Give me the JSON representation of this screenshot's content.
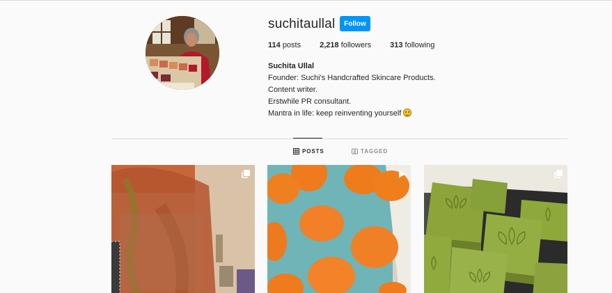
{
  "profile": {
    "username": "suchitaullal",
    "follow_label": "Follow",
    "stats": {
      "posts_count": "114",
      "posts_label": "posts",
      "followers_count": "2,218",
      "followers_label": "followers",
      "following_count": "313",
      "following_label": "following"
    },
    "full_name": "Suchita Ullal",
    "bio_lines": [
      "Founder: Suchi's Handcrafted Skincare Products.",
      "Content writer.",
      "Erstwhile PR consultant.",
      "Mantra in life: keep reinventing yourself"
    ],
    "bio_emoji": "slightly-smiling-face-emoji"
  },
  "tabs": [
    {
      "label": "POSTS",
      "icon": "grid-icon",
      "active": true
    },
    {
      "label": "TAGGED",
      "icon": "tagged-icon",
      "active": false
    }
  ],
  "posts": [
    {
      "icon": "multiple-images-icon",
      "subject": "wrapped soap gift in orange mesh"
    },
    {
      "icon": "video-play-icon",
      "subject": "orange soap rounds in blue mold"
    },
    {
      "icon": "multiple-images-icon",
      "subject": "green lotus-stamped soap bars"
    }
  ],
  "colors": {
    "accent": "#0095f6",
    "text": "#262626",
    "muted": "#8e8e8e",
    "border": "#dbdbdb",
    "background": "#fafafa"
  }
}
